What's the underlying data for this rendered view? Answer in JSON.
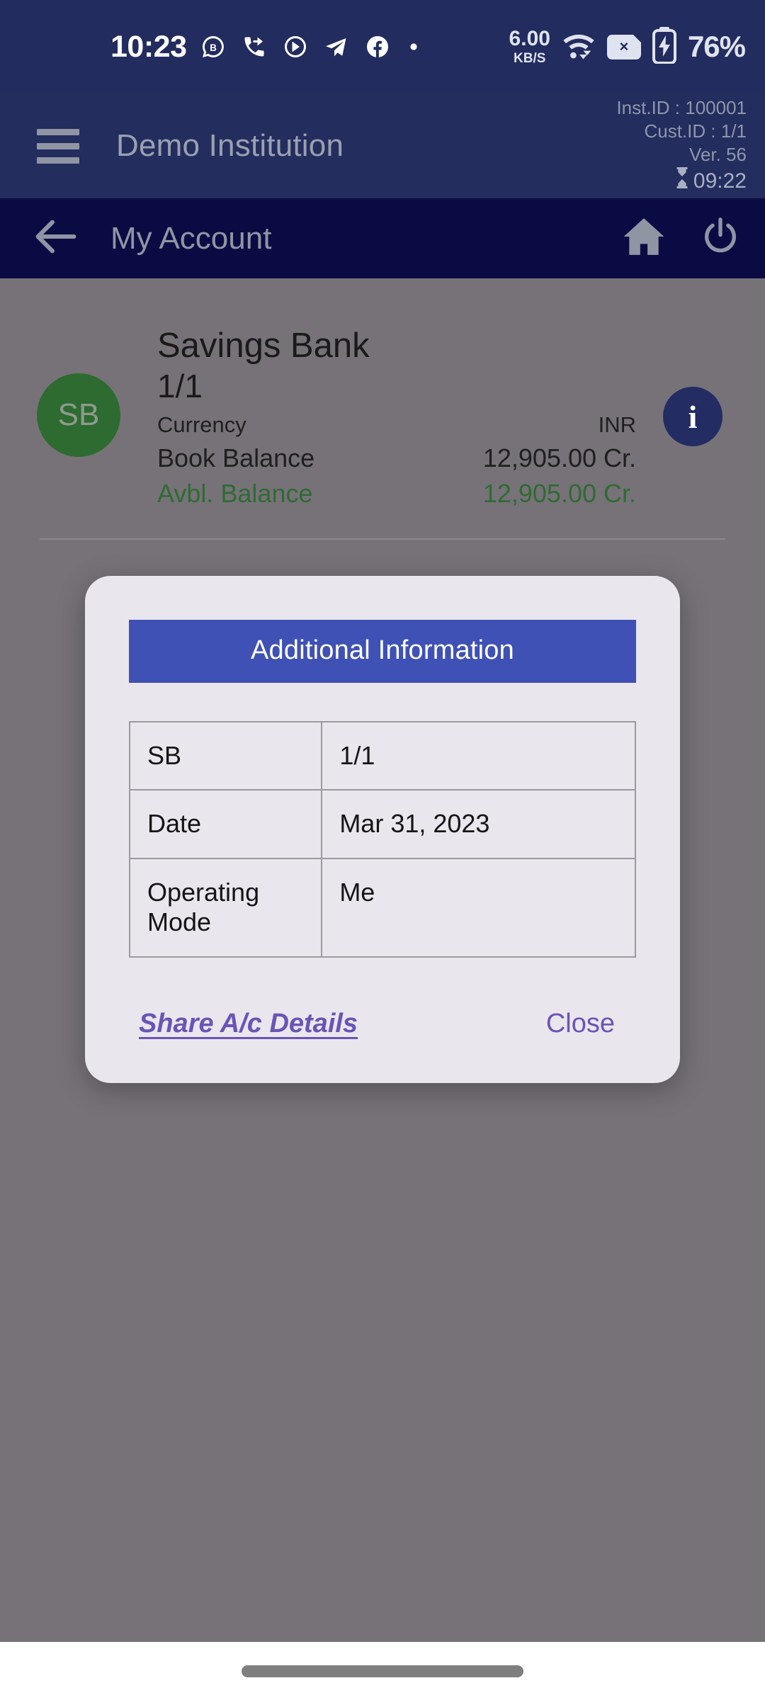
{
  "status_bar": {
    "time": "10:23",
    "icons": [
      "whatsapp-business-icon",
      "call-forward-icon",
      "circular-play-icon",
      "telegram-icon",
      "facebook-icon",
      "dot-icon"
    ],
    "network_speed_value": "6.00",
    "network_speed_unit": "KB/S",
    "wifi": "wifi-icon",
    "sim_status": "×",
    "battery_percent": "76%",
    "background_color": "#222c5e"
  },
  "header": {
    "menu_icon": "hamburger-menu-icon",
    "institution_name": "Demo Institution",
    "inst_id": "Inst.ID : 100001",
    "cust_id": "Cust.ID : 1/1",
    "version": "Ver. 56",
    "session_timer": "09:22",
    "timer_icon": "⌛",
    "background_color": "#232d5e"
  },
  "app_bar": {
    "back_icon": "back-arrow-icon",
    "title": "My Account",
    "home_icon": "home-icon",
    "power_icon": "power-icon",
    "background_color": "#0b0b44"
  },
  "account_card": {
    "avatar_initials": "SB",
    "avatar_color": "#2d6b30",
    "title": "Savings Bank",
    "account_number": "1/1",
    "currency_label": "Currency",
    "currency_value": "INR",
    "book_balance_label": "Book Balance",
    "book_balance_value": "12,905.00 Cr.",
    "avbl_balance_label": "Avbl. Balance",
    "avbl_balance_value": "12,905.00 Cr.",
    "avbl_balance_color": "#2f6b33",
    "info_icon": "info-icon"
  },
  "dialog": {
    "header_title": "Additional Information",
    "header_color": "#3f51b5",
    "background_color": "#eae6ed",
    "rows": [
      {
        "key": "SB",
        "value": "1/1"
      },
      {
        "key": "Date",
        "value": "Mar 31, 2023"
      },
      {
        "key": "Operating Mode",
        "value": "Me"
      }
    ],
    "share_label": "Share A/c Details",
    "close_label": "Close",
    "action_color": "#6a54b5"
  },
  "nav_bar": {
    "gesture_pill": "home-gesture-pill"
  }
}
